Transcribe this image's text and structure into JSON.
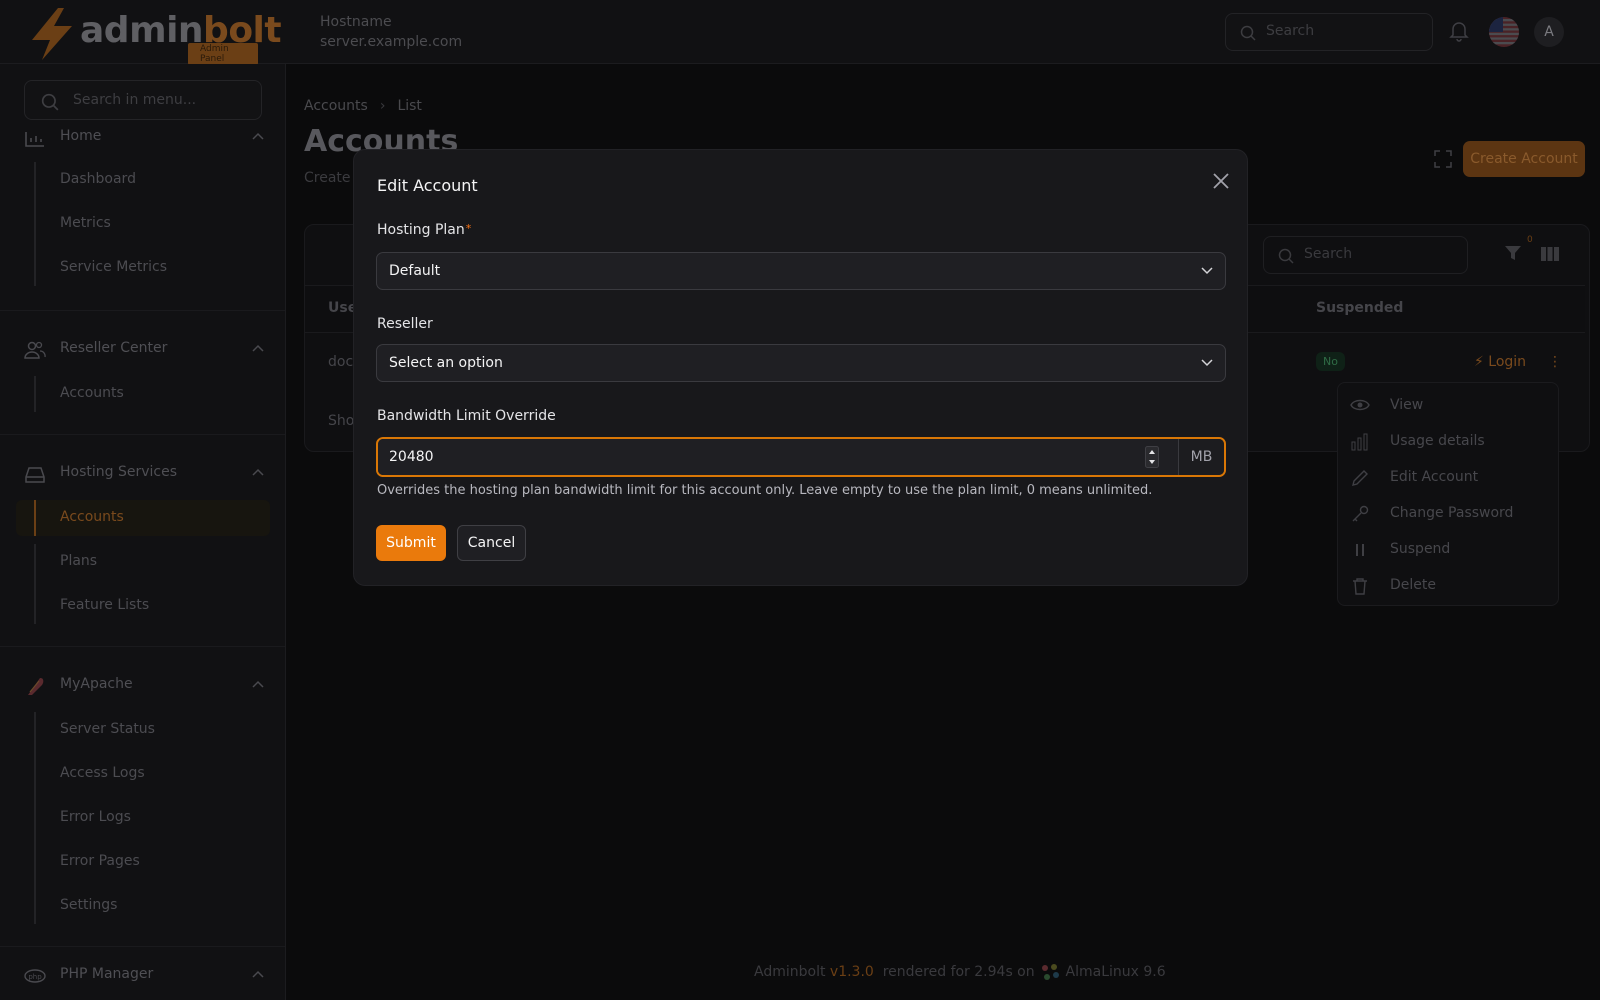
{
  "brand": {
    "name_a": "admin",
    "name_b": "bolt",
    "tag": "Admin Panel"
  },
  "header": {
    "hostname_label": "Hostname",
    "hostname_value": "server.example.com",
    "search_placeholder": "Search",
    "avatar_initial": "A"
  },
  "sidebar": {
    "search_placeholder": "Search in menu...",
    "groups": [
      {
        "label": "Home",
        "icon": "chart-icon",
        "items": [
          "Dashboard",
          "Metrics",
          "Service Metrics"
        ]
      },
      {
        "label": "Reseller Center",
        "icon": "users-icon",
        "items": [
          "Accounts"
        ]
      },
      {
        "label": "Hosting Services",
        "icon": "server-icon",
        "items": [
          "Accounts",
          "Plans",
          "Feature Lists"
        ],
        "active_item": "Accounts"
      },
      {
        "label": "MyApache",
        "icon": "apache-feather-icon",
        "items": [
          "Server Status",
          "Access Logs",
          "Error Logs",
          "Error Pages",
          "Settings"
        ]
      },
      {
        "label": "PHP Manager",
        "icon": "php-icon",
        "items": []
      }
    ]
  },
  "main": {
    "breadcrumb": [
      "Accounts",
      "List"
    ],
    "title": "Accounts",
    "subtitle": "Create a",
    "create_button": "Create Account",
    "table": {
      "search_placeholder": "Search",
      "filter_count": "0",
      "columns": {
        "user": "Use",
        "suspended": "Suspended"
      },
      "rows": [
        {
          "user": "doc",
          "suspended": "No",
          "action": "Login"
        }
      ],
      "footer_text": "Sho"
    },
    "row_menu": [
      "View",
      "Usage details",
      "Edit Account",
      "Change Password",
      "Suspend",
      "Delete"
    ]
  },
  "footer": {
    "prefix": "Adminbolt",
    "version": "v1.3.0",
    "middle": "rendered for 2.94s on",
    "os": "AlmaLinux 9.6"
  },
  "modal": {
    "title": "Edit Account",
    "hosting_plan": {
      "label": "Hosting Plan",
      "required_mark": "*",
      "value": "Default"
    },
    "reseller": {
      "label": "Reseller",
      "value": "Select an option"
    },
    "bandwidth": {
      "label": "Bandwidth Limit Override",
      "value": "20480",
      "unit": "MB",
      "help": "Overrides the hosting plan bandwidth limit for this account only. Leave empty to use the plan limit, 0 means unlimited."
    },
    "submit_label": "Submit",
    "cancel_label": "Cancel"
  },
  "colors": {
    "accent": "#ea7a0c",
    "focus_border": "#d97706",
    "modal_bg": "#18181b",
    "page_bg": "#0b0b0c"
  }
}
